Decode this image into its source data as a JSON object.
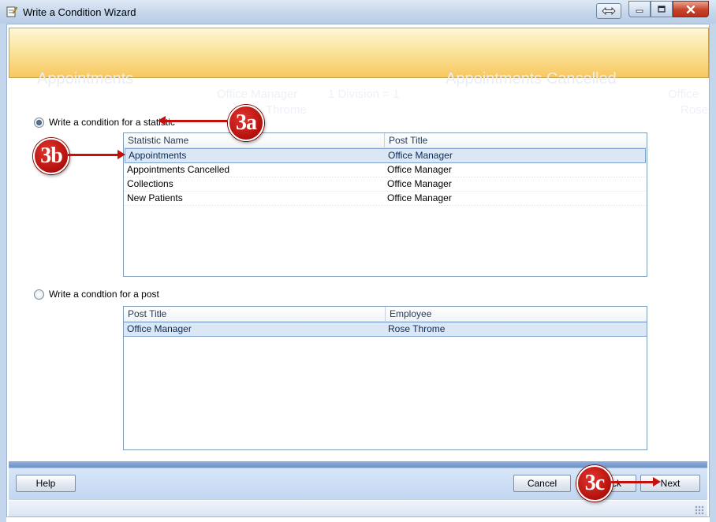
{
  "window": {
    "title": "Write a Condition Wizard",
    "icons": {
      "app": "wizard-notepad-icon",
      "resize": "resize-arrows-icon",
      "minimize": "minimize-icon",
      "maximize": "maximize-icon",
      "close": "close-icon"
    }
  },
  "watermark": {
    "left_title": "Appointments",
    "right_title": "Appointments Cancelled",
    "left_post": "Office Manager",
    "left_employee": "Throme",
    "division": "1 Division  = 1",
    "right_post": "Office",
    "right_employee": "Rose"
  },
  "statistic_section": {
    "option_label": "Write a condition for a statistic",
    "selected": true,
    "columns": [
      "Statistic Name",
      "Post Title"
    ],
    "rows": [
      {
        "name": "Appointments",
        "post": "Office Manager",
        "selected": true
      },
      {
        "name": "Appointments Cancelled",
        "post": "Office Manager",
        "selected": false
      },
      {
        "name": "Collections",
        "post": "Office Manager",
        "selected": false
      },
      {
        "name": "New Patients",
        "post": "Office Manager",
        "selected": false
      }
    ]
  },
  "post_section": {
    "option_label": "Write a condtion for a post",
    "selected": false,
    "columns": [
      "Post Title",
      "Employee"
    ],
    "rows": [
      {
        "post": "Office Manager",
        "employee": "Rose Throme",
        "selected": true
      }
    ]
  },
  "footer": {
    "help_label": "Help",
    "cancel_label": "Cancel",
    "back_label": "< Back",
    "next_label": "Next"
  },
  "callouts": {
    "a": "3a",
    "b": "3b",
    "c": "3c"
  },
  "colors": {
    "callout": "#c4100b",
    "header_band": "#f7c860",
    "footer": "#c2d6f1",
    "selection": "#dbe7f5"
  }
}
